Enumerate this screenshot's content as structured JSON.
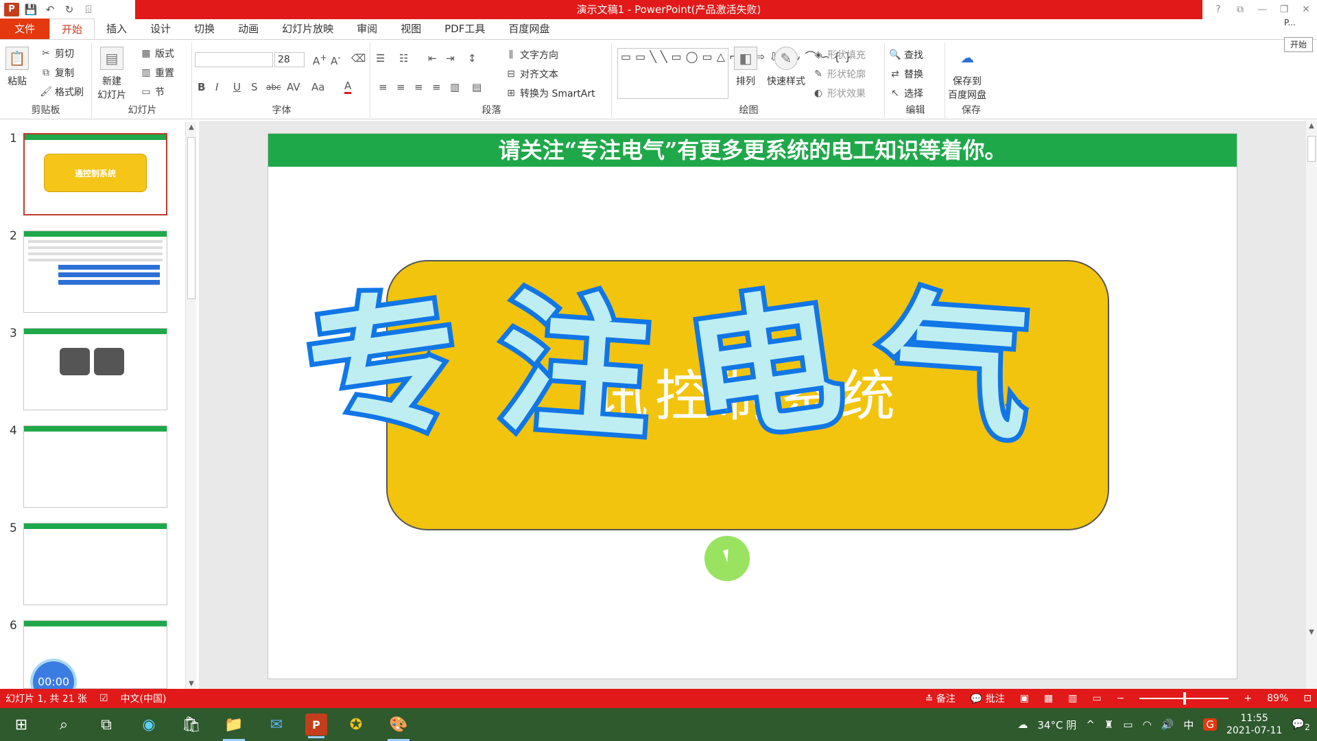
{
  "window": {
    "title": "演示文稿1 - PowerPoint(产品激活失败)",
    "controls": [
      "?",
      "⧉",
      "—",
      "❐",
      "✕"
    ]
  },
  "qat": {
    "logo": "P",
    "icons": [
      "save-icon",
      "undo-icon",
      "redo-icon",
      "present-icon"
    ]
  },
  "tabs": [
    "文件",
    "开始",
    "插入",
    "设计",
    "切换",
    "动画",
    "幻灯片放映",
    "审阅",
    "视图",
    "PDF工具",
    "百度网盘"
  ],
  "side": {
    "mini_label": "P...",
    "start_btn": "开始"
  },
  "ribbon": {
    "clipboard": {
      "paste": "粘贴",
      "cut": "剪切",
      "copy": "复制",
      "format_painter": "格式刷",
      "label": "剪贴板"
    },
    "slides": {
      "new_slide": "新建\n幻灯片",
      "layout": "版式",
      "reset": "重置",
      "section": "节",
      "label": "幻灯片"
    },
    "font": {
      "font_name": "",
      "font_size": "28",
      "label": "字体",
      "formats": [
        "B",
        "I",
        "U",
        "S",
        "abc",
        "AV",
        "Aa",
        "A"
      ]
    },
    "paragraph": {
      "text_direction": "文字方向",
      "align_text": "对齐文本",
      "smartart": "转换为 SmartArt",
      "label": "段落"
    },
    "drawing": {
      "arrange": "排列",
      "quick_styles": "快速样式",
      "shape_fill": "形状填充",
      "shape_outline": "形状轮廓",
      "shape_effects": "形状效果",
      "label": "绘图",
      "shapes": "▭▭╲╲▭◯▭△⌐⌐⇨⇩⌜∿⌒∽{}"
    },
    "editing": {
      "find": "查找",
      "replace": "替换",
      "select": "选择",
      "label": "编辑"
    },
    "save": {
      "save_baidu": "保存到\n百度网盘",
      "label": "保存"
    }
  },
  "thumbnails": [
    {
      "num": "1",
      "title": "通控制系统"
    },
    {
      "num": "2"
    },
    {
      "num": "3"
    },
    {
      "num": "4"
    },
    {
      "num": "5"
    },
    {
      "num": "6"
    }
  ],
  "timer": "00:00",
  "slide": {
    "banner": "请关注“专注电气”有更多更系统的电工知识等着你。",
    "box_text": "讯控制系统",
    "watermark": [
      "专",
      "注",
      "电",
      "气"
    ]
  },
  "status": {
    "slide_info": "幻灯片 1, 共 21 张",
    "language": "中文(中国)",
    "notes": "备注",
    "comments": "批注",
    "zoom": "89%"
  },
  "taskbar": {
    "weather": "34°C 阴",
    "ime": "中",
    "time": "11:55",
    "date": "2021-07-11",
    "notif_count": "2"
  },
  "colors": {
    "accent_red": "#e11919",
    "banner_green": "#1fa84a",
    "box_yellow": "#f2c40e",
    "wm_blue": "#1176e6"
  }
}
